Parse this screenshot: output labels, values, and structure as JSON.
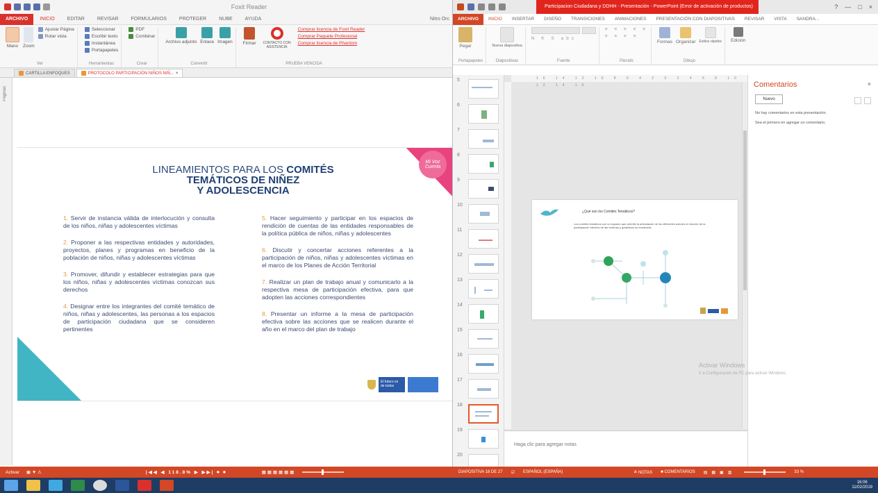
{
  "left": {
    "window_title": "Foxit Reader",
    "file_tab": "ARCHIVO",
    "tabs": [
      "INICIO",
      "EDITAR",
      "REVISAR",
      "FORMULARIOS",
      "PROTEGER",
      "NUBE",
      "AYUDA"
    ],
    "tab_right": "Nitro Orc",
    "ribbon": {
      "mano": "Mano",
      "zoom": "Zoom",
      "ajustar_pagina": "Ajustar Página",
      "rotar_vista": "Rotar vista",
      "seleccionar": "Seleccionar",
      "escribir_texto": "Escribir texto",
      "pdf": "PDF",
      "combinar": "Combinar",
      "instantanea": "Instantánea",
      "portapapeles": "Portapapeles",
      "archivo_adjunto": "Archivo adjunto",
      "enlace": "Enlace",
      "imagen": "Imagen",
      "firmar": "Firmar",
      "contacto": "CONTACTO CON ASISTENCIA",
      "links": [
        "Comprar licencia de Foxit Reader",
        "Comprar Paquete Profesional",
        "Comprar licencia de Phantom"
      ],
      "group_vista": "Ver",
      "group_herramientas": "Herramientas",
      "group_crear": "Crear",
      "group_convertir": "Convertir",
      "group_prueba": "PRUEBA VENCIDA"
    },
    "doc_tabs": [
      "CARTILLA ENFOQUES",
      "PROTOCOLO PARTICIPACIÓN NIÑOS NIÑ..."
    ],
    "side_label": "Páginas",
    "slide": {
      "badge": "Mi Voz Cuenta",
      "title_line1": "LINEAMIENTOS PARA LOS",
      "title_bold1": "COMITÉS",
      "title_line2": "TEMÁTICOS DE NIÑEZ",
      "title_line3": "Y ADOLESCENCIA",
      "items_left": [
        {
          "num": "1.",
          "text": "Servir de instancia válida de interlocución y consulta de los niños, niñas y adolescentes víctimas"
        },
        {
          "num": "2.",
          "text": "Proponer a las respectivas entidades y autoridades, proyectos, planes y programas en beneficio de la población de niños, niñas y adolescentes víctimas"
        },
        {
          "num": "3.",
          "text": "Promover, difundir y establecer estrategias para que los niños, niñas y adolescentes víctimas conozcan sus derechos"
        },
        {
          "num": "4.",
          "text": "Designar entre los integrantes del comité temático de niños, niñas y adolescentes, las personas a los espacios de participación ciudadana que se consideren pertinentes"
        }
      ],
      "items_right": [
        {
          "num": "5.",
          "text": "Hacer seguimiento y participar en los espacios de rendición de cuentas de las entidades responsables de la política pública de niños, niñas y adolescentes"
        },
        {
          "num": "6.",
          "text": "Discutir y concertar acciones referentes a la participación de niños, niñas y adolescentes víctimas en el marco de los Planes de Acción Territorial"
        },
        {
          "num": "7.",
          "text": "Realizar un plan de trabajo anual y comunicarlo a la respectiva mesa de participación efectiva, para que adopten las acciones correspondientes"
        },
        {
          "num": "8.",
          "text": "Presentar un informe a la mesa de participación efectiva sobre las acciones que se realicen durante el año en el marco del plan de trabajo"
        }
      ],
      "gov_logo": "El futuro es de todos"
    },
    "status": {
      "left": "Activar",
      "zoom": "118.8%"
    }
  },
  "right": {
    "title": "Participacion Ciudadana y DDHH - Presentación - PowerPoint (Error de activación de productos)",
    "controls": [
      "?",
      "—",
      "□",
      "×"
    ],
    "file_tab": "ARCHIVO",
    "tabs": [
      "INICIO",
      "INSERTAR",
      "DISEÑO",
      "TRANSICIONES",
      "ANIMACIONES",
      "PRESENTACIÓN CON DIAPOSITIVAS",
      "REVISAR",
      "VISTA",
      "SANDRA..."
    ],
    "ribbon": {
      "pegar": "Pegar",
      "nueva_diapositiva": "Nueva diapositiva",
      "formas": "Formas",
      "organizar": "Organizar",
      "estilos_rapidos": "Estilos rápidos",
      "edicion": "Edición",
      "group_portapapeles": "Portapapeles",
      "group_diapositivas": "Diapositivas",
      "group_fuente": "Fuente",
      "group_parrafo": "Párrafo",
      "group_dibujo": "Dibujo"
    },
    "thumb_numbers": [
      "5",
      "6",
      "7",
      "8",
      "9",
      "10",
      "11",
      "12",
      "13",
      "14",
      "15",
      "16",
      "17",
      "18",
      "19",
      "20"
    ],
    "ruler": "16 14 12 10 8 6 4 2 0 2 4 6 8 10 12 14 16",
    "slide_heading": "¿Qué son los Comités Temáticos?",
    "slide_body": "Los comités temáticos son un espacio que permite la articulación de los diferentes actores en función de la participación efectiva de las víctimas y garantizar su incidencia.",
    "notes": "Haga clic para agregar notas",
    "comments": {
      "title": "Comentarios",
      "new_button": "Nuevo",
      "msg1": "No hay comentarios en esta presentación.",
      "msg2": "Sea el primero en agregar un comentario."
    },
    "watermark_title": "Activar Windows",
    "watermark_sub": "Ir a Configuración de PC para activar Windows.",
    "status": {
      "slide": "DIAPOSITIVA 18 DE 27",
      "lang": "ESPAÑOL (ESPAÑA)",
      "notas": "NOTAS",
      "comentarios": "COMENTARIOS",
      "zoom": "33 %"
    }
  },
  "taskbar": {
    "time": "16:06",
    "date": "11/02/2019"
  }
}
